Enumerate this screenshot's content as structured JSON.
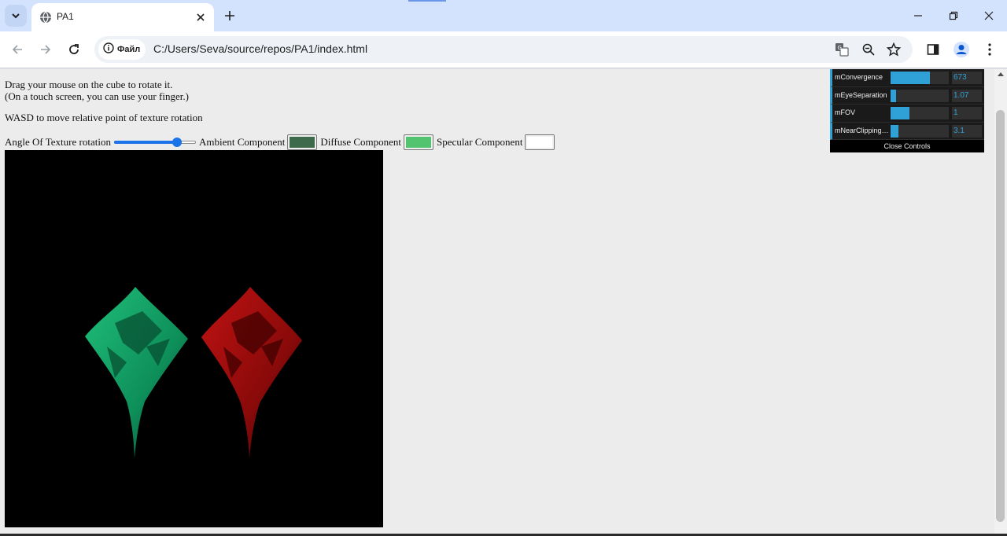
{
  "browser": {
    "tab_title": "PA1",
    "address_chip": "Файл",
    "url": "C:/Users/Seva/source/repos/PA1/index.html",
    "icons": [
      "tab-search-icon",
      "globe-icon",
      "close-icon",
      "plus-icon",
      "minimize-icon",
      "restore-icon",
      "window-close-icon",
      "back-arrow-icon",
      "forward-arrow-icon",
      "reload-icon",
      "info-icon",
      "translate-icon",
      "zoom-icon",
      "bookmark-star-icon",
      "side-panel-icon",
      "profile-icon",
      "menu-dots-icon"
    ]
  },
  "page": {
    "instruction_1": "Drag your mouse on the cube to rotate it.",
    "instruction_2": "(On a touch screen, you can use your finger.)",
    "instruction_3": "WASD to move relative point of texture rotation",
    "angle_label": "Angle Of Texture rotation",
    "angle_slider_fraction": 0.8,
    "ambient_label": "Ambient Component",
    "ambient_color": "#3d6a4a",
    "diffuse_label": "Diffuse Component",
    "diffuse_color": "#52c36e",
    "specular_label": "Specular Component",
    "specular_color": "#ffffff"
  },
  "gui": {
    "controls": [
      {
        "name": "mConvergence",
        "value": "673",
        "fraction": 0.67
      },
      {
        "name": "mEyeSeparation",
        "value": "1.07",
        "fraction": 0.1
      },
      {
        "name": "mFOV",
        "value": "1",
        "fraction": 0.33
      },
      {
        "name": "mNearClippingD...",
        "value": "3.1",
        "fraction": 0.14
      }
    ],
    "close_label": "Close Controls",
    "accent_color": "#2fa1d6"
  }
}
